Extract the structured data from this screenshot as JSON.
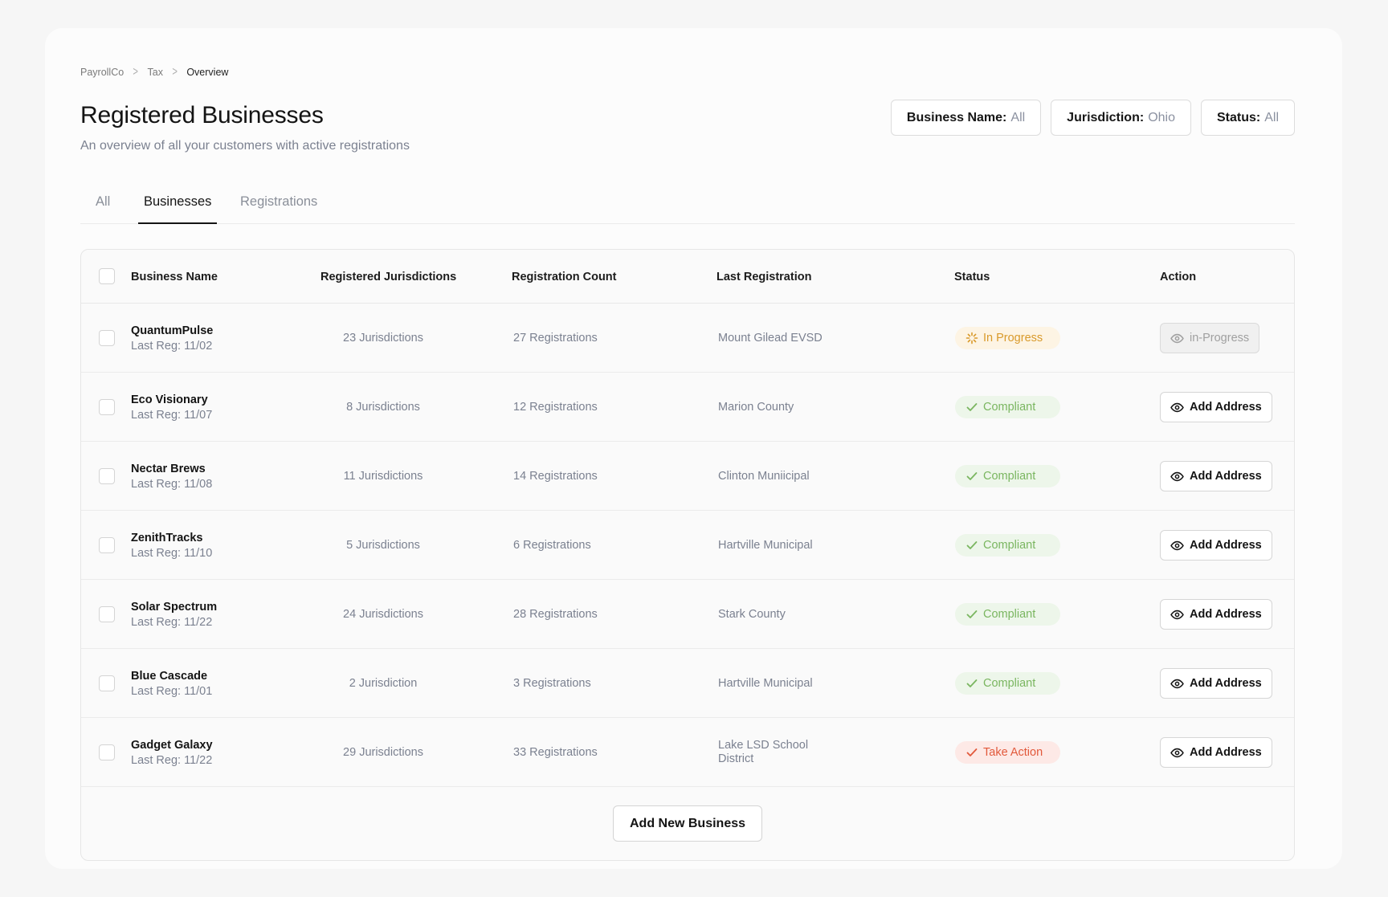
{
  "breadcrumb": [
    "PayrollCo",
    "Tax",
    "Overview"
  ],
  "header": {
    "title": "Registered Businesses",
    "subtitle": "An overview of all your customers with active registrations"
  },
  "filters": [
    {
      "label": "Business Name:",
      "value": "All"
    },
    {
      "label": "Jurisdiction:",
      "value": "Ohio"
    },
    {
      "label": "Status:",
      "value": "All"
    }
  ],
  "tabs": [
    {
      "label": "All",
      "active": false
    },
    {
      "label": "Businesses",
      "active": true
    },
    {
      "label": "Registrations",
      "active": false
    }
  ],
  "columns": [
    "Business Name",
    "Registered Jurisdictions",
    "Registration Count",
    "Last Registration",
    "Status",
    "Action"
  ],
  "rows": [
    {
      "name": "QuantumPulse",
      "last_reg": "Last Reg: 11/02",
      "jurisdictions": "23 Jurisdictions",
      "registrations": "27 Registrations",
      "last_registration": "Mount Gilead EVSD",
      "status": "In Progress",
      "status_type": "progress",
      "action": "in-Progress",
      "action_disabled": true
    },
    {
      "name": "Eco Visionary",
      "last_reg": "Last Reg: 11/07",
      "jurisdictions": "8 Jurisdictions",
      "registrations": "12 Registrations",
      "last_registration": "Marion County",
      "status": "Compliant",
      "status_type": "ok",
      "action": "Add Address",
      "action_disabled": false
    },
    {
      "name": "Nectar Brews",
      "last_reg": "Last Reg: 11/08",
      "jurisdictions": "11 Jurisdictions",
      "registrations": "14 Registrations",
      "last_registration": "Clinton Muniicipal",
      "status": "Compliant",
      "status_type": "ok",
      "action": "Add Address",
      "action_disabled": false
    },
    {
      "name": "ZenithTracks",
      "last_reg": "Last Reg: 11/10",
      "jurisdictions": "5 Jurisdictions",
      "registrations": "6 Registrations",
      "last_registration": "Hartville Municipal",
      "status": "Compliant",
      "status_type": "ok",
      "action": "Add Address",
      "action_disabled": false
    },
    {
      "name": "Solar Spectrum",
      "last_reg": "Last Reg: 11/22",
      "jurisdictions": "24 Jurisdictions",
      "registrations": "28 Registrations",
      "last_registration": "Stark County",
      "status": "Compliant",
      "status_type": "ok",
      "action": "Add Address",
      "action_disabled": false
    },
    {
      "name": "Blue Cascade",
      "last_reg": "Last Reg: 11/01",
      "jurisdictions": "2 Jurisdiction",
      "registrations": "3 Registrations",
      "last_registration": "Hartville Municipal",
      "status": "Compliant",
      "status_type": "ok",
      "action": "Add Address",
      "action_disabled": false
    },
    {
      "name": "Gadget Galaxy",
      "last_reg": "Last Reg: 11/22",
      "jurisdictions": "29 Jurisdictions",
      "registrations": "33 Registrations",
      "last_registration": "Lake LSD School District",
      "status": "Take Action",
      "status_type": "action",
      "action": "Add Address",
      "action_disabled": false
    }
  ],
  "footer": {
    "add_button": "Add New Business"
  }
}
